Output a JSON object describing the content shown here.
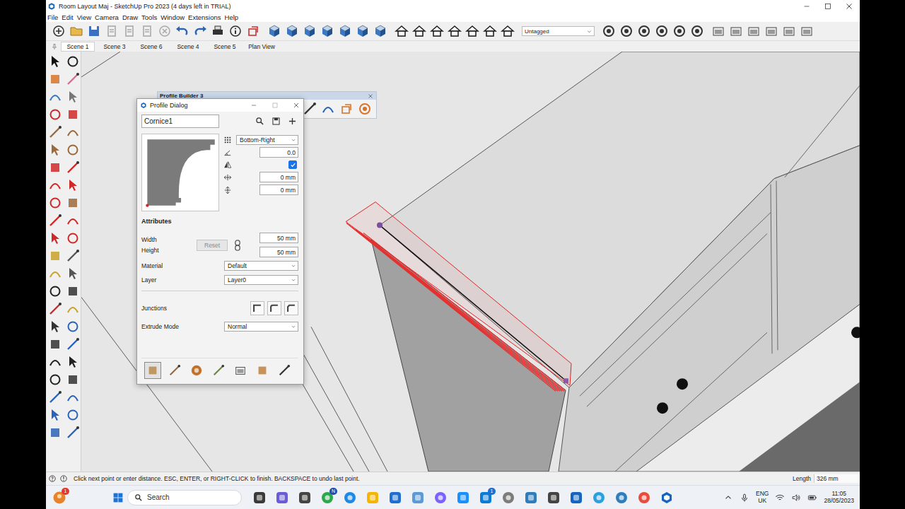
{
  "window": {
    "title": "Room Layout Maj - SketchUp Pro 2023 (4 days left in TRIAL)"
  },
  "menu": [
    "File",
    "Edit",
    "View",
    "Camera",
    "Draw",
    "Tools",
    "Window",
    "Extensions",
    "Help"
  ],
  "toolbar": {
    "tag": "Untagged"
  },
  "scenes": [
    {
      "label": "Scene 1",
      "selected": true
    },
    {
      "label": "Scene 3",
      "selected": false
    },
    {
      "label": "Scene 6",
      "selected": false
    },
    {
      "label": "Scene 4",
      "selected": false
    },
    {
      "label": "Scene 5",
      "selected": false
    },
    {
      "label": "Plan View",
      "selected": false
    }
  ],
  "profile_builder": {
    "title": "Profile Builder 3"
  },
  "profile_dialog": {
    "title": "Profile Dialog",
    "profile_name": "Cornice1",
    "anchor": "Bottom-Right",
    "rotation": "0.0",
    "mirror": true,
    "offset_x": "0 mm",
    "offset_y": "0 mm",
    "attributes_heading": "Attributes",
    "size_fields": [
      {
        "label": "Width",
        "value": "50 mm"
      },
      {
        "label": "Height",
        "value": "50 mm"
      }
    ],
    "reset": {
      "label": "Reset",
      "disabled": true
    },
    "material": {
      "label": "Material",
      "value": "Default"
    },
    "layer": {
      "label": "Layer",
      "value": "Layer0"
    },
    "junctions": {
      "label": "Junctions"
    },
    "extrude_mode": {
      "label": "Extrude Mode",
      "value": "Normal"
    },
    "tools": [
      {
        "selected": true
      },
      {
        "selected": false
      },
      {
        "selected": false
      },
      {
        "selected": false
      },
      {
        "selected": false
      },
      {
        "selected": false
      },
      {
        "selected": false
      }
    ]
  },
  "status_bar": {
    "hint": "Click next point or enter distance. ESC, ENTER, or RIGHT-CLICK to finish. BACKSPACE to undo last point.",
    "measure_label": "Length",
    "measure_value": "326 mm"
  },
  "taskbar": {
    "search_placeholder": "Search",
    "profile_badge": "1",
    "browser_badge": "N",
    "mail_badge": "1",
    "language": "ENG",
    "region": "UK",
    "time": "11:05",
    "date": "28/05/2023"
  }
}
